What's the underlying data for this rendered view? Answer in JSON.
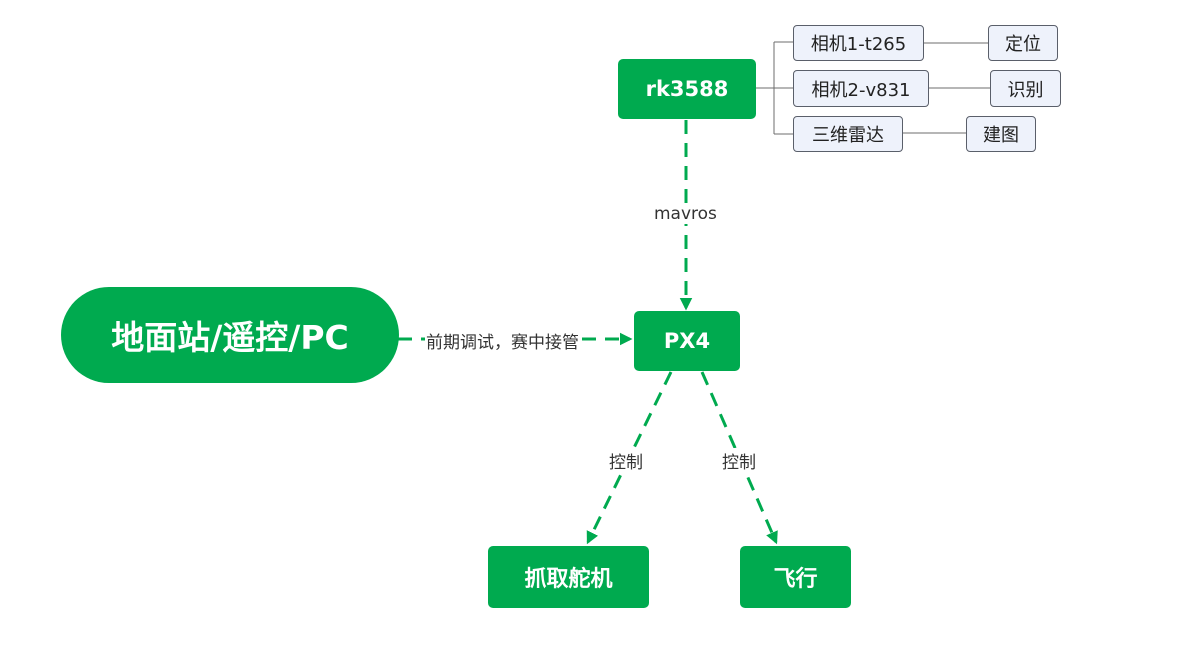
{
  "diagram": {
    "nodes": {
      "ground": "地面站/遥控/PC",
      "rk3588": "rk3588",
      "px4": "PX4",
      "grab": "抓取舵机",
      "fly": "飞行"
    },
    "sensors": [
      {
        "name": "相机1-t265",
        "role": "定位"
      },
      {
        "name": "相机2-v831",
        "role": "识别"
      },
      {
        "name": "三维雷达",
        "role": "建图"
      }
    ],
    "edges": {
      "rk_to_px4": "mavros",
      "ground_to_px4": "前期调试，赛中接管",
      "px4_to_grab": "控制",
      "px4_to_fly": "控制"
    },
    "colors": {
      "accent": "#00aa4f",
      "sub_fill": "#eef2fb",
      "sub_border": "#5a5f6a"
    }
  }
}
